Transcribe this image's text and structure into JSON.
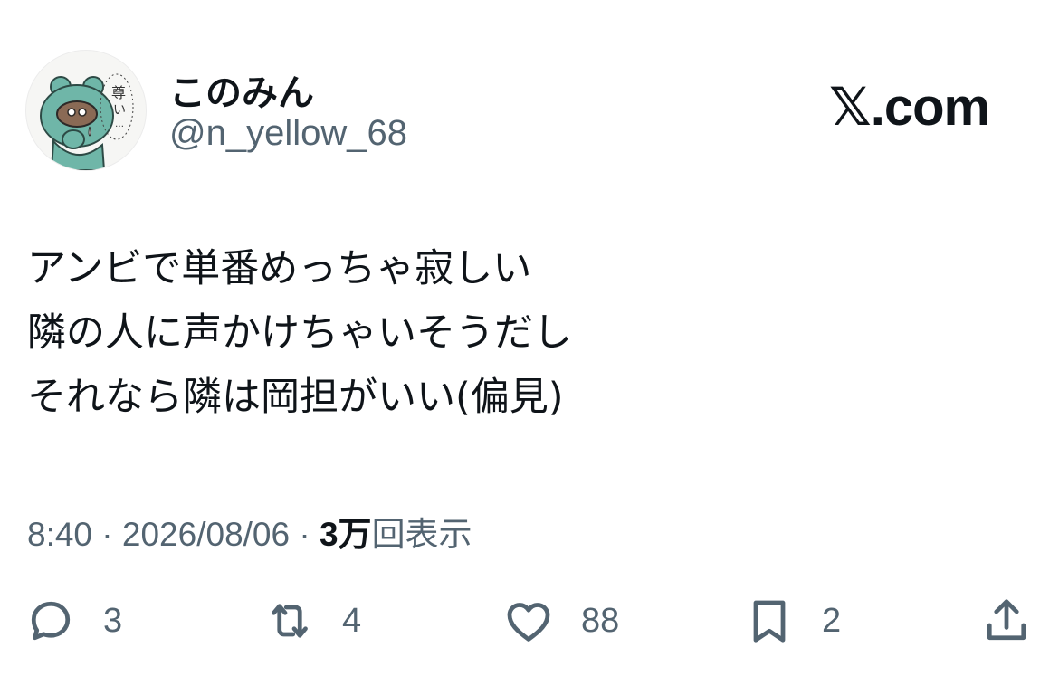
{
  "author": {
    "display_name": "このみん",
    "handle": "@n_yellow_68",
    "avatar_icon": "bear-avatar-icon",
    "avatar_text": "尊い……"
  },
  "brand": {
    "label": "𝕏.com"
  },
  "tweet": {
    "lines": [
      "アンビで単番めっちゃ寂しい",
      "隣の人に声かけちゃいそうだし",
      "それなら隣は岡担がいい(偏見)"
    ]
  },
  "meta": {
    "time": "8:40",
    "separator": "·",
    "date": "2026/08/06",
    "views_count": "3万",
    "views_label": "回表示"
  },
  "actions": {
    "reply": {
      "icon": "reply-icon",
      "count": "3"
    },
    "retweet": {
      "icon": "retweet-icon",
      "count": "4"
    },
    "like": {
      "icon": "heart-icon",
      "count": "88"
    },
    "bookmark": {
      "icon": "bookmark-icon",
      "count": "2"
    },
    "share": {
      "icon": "share-icon"
    }
  },
  "colors": {
    "text_primary": "#0f1419",
    "text_secondary": "#536471",
    "avatar_bear": "#6fb6a8"
  }
}
